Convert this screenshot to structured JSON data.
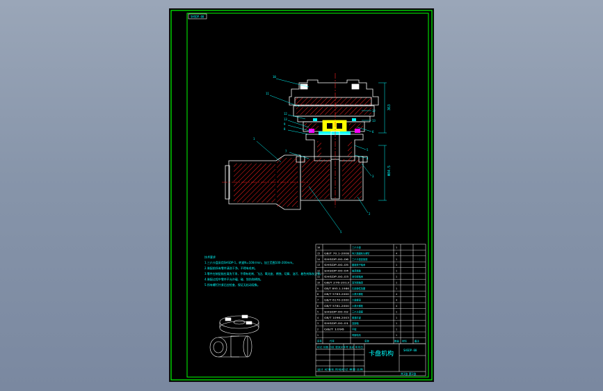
{
  "drawing_code": "SHSDP-00",
  "title_block": {
    "title": "卡盘机构",
    "code": "SHSDP-00",
    "row_a": "标记 处数 分区 更改文件号 签名 年月日",
    "row_b": "设计 标准化 阶段标记 重量 比例",
    "row_c": "共1张 第1张"
  },
  "tech_requirements": {
    "heading": "技术要求",
    "lines": [
      "1.三爪卡盘采用SHSDP-1，转速N=100r/min，加工范围100-200mm。",
      "2.装配前所有零件清洗干净，不得有毛刺。",
      "3.零件在装配前应清洗干净，不得有毛刺、飞边、氧化皮、锈蚀、切屑、油污、着色剂和灰尘等。",
      "4.装配过程中零件不允许磕、碰、划伤和锈蚀。",
      "5.所有螺钉拧紧后应检查，保证无松动现象。"
    ]
  },
  "callouts": [
    "10",
    "11",
    "12",
    "13",
    "9",
    "8",
    "7",
    "6",
    "5",
    "4",
    "3",
    "2",
    "1"
  ],
  "dimensions": [
    "363",
    "Φ84.5"
  ],
  "bom": {
    "rows": [
      {
        "no": "16",
        "code": "",
        "name": "三爪卡盘",
        "qty": "1"
      },
      {
        "no": "15",
        "code": "GB/T 70.1-2008",
        "name": "内六角圆柱头螺钉",
        "qty": "4"
      },
      {
        "no": "14",
        "code": "SHSDP-00-06",
        "name": "三爪卡盘连接座",
        "qty": "1"
      },
      {
        "no": "13",
        "code": "SHSDP-00-05",
        "name": "圆锥滚子轴承",
        "qty": "1"
      },
      {
        "no": "12",
        "code": "SHSDP-00-04",
        "name": "轴承端盖",
        "qty": "1"
      },
      {
        "no": "11",
        "code": "SHSDP-00-03",
        "name": "深沟球轴承",
        "qty": "1"
      },
      {
        "no": "10",
        "code": "GB/T 276-2013",
        "name": "深沟球轴承",
        "qty": "1"
      },
      {
        "no": "9",
        "code": "GB/T 893.1-1986",
        "name": "孔用弹性挡圈",
        "qty": "1"
      },
      {
        "no": "8",
        "code": "GB/T 5783-2000",
        "name": "六角头螺栓",
        "qty": "4"
      },
      {
        "no": "7",
        "code": "GB/T 6170-2000",
        "name": "六角螺母",
        "qty": "4"
      },
      {
        "no": "6",
        "code": "GB/T 5781-2000",
        "name": "六角头螺栓",
        "qty": "4"
      },
      {
        "no": "5",
        "code": "SHSDP-00-02",
        "name": "三爪卡盘座",
        "qty": "1"
      },
      {
        "no": "4",
        "code": "GB/T 1096-2003",
        "name": "普通平键",
        "qty": "1"
      },
      {
        "no": "3",
        "code": "SHSDP-00-01",
        "name": "连接轴",
        "qty": "1"
      },
      {
        "no": "2",
        "code": "GB/T 1096",
        "name": "平键",
        "qty": "1"
      },
      {
        "no": "1",
        "code": "",
        "name": "伺服电机",
        "qty": "1"
      }
    ],
    "header": {
      "no": "序号",
      "code": "代号",
      "name": "名称",
      "qty": "数量",
      "material": "材料",
      "remark": "备注"
    }
  },
  "colors": {
    "frame": "#00ff00",
    "outline": "#ffffff",
    "hatch": "#ff0000",
    "center": "#ff0000",
    "text": "#00ffff",
    "leader": "#00ffff",
    "part": "#ffff00",
    "background": "#000000"
  }
}
